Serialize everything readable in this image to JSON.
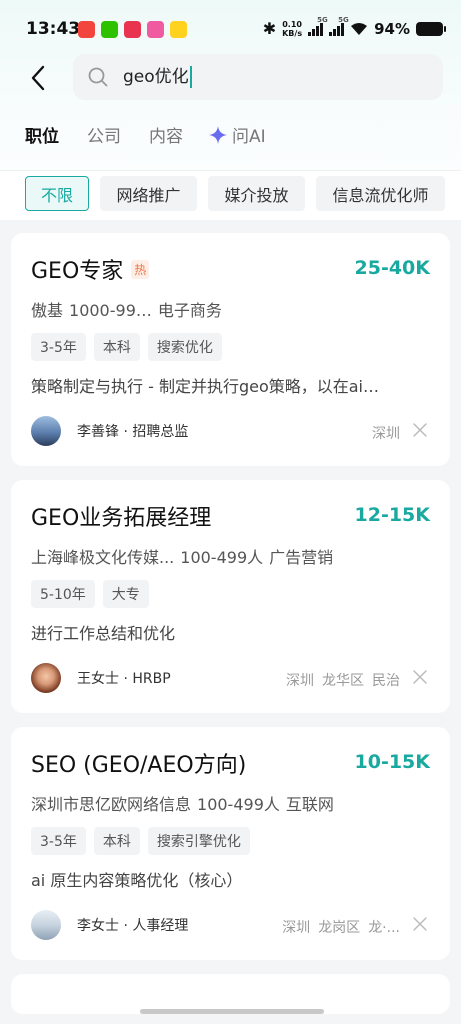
{
  "status_bar": {
    "time": "13:43",
    "speed_value": "0.10",
    "speed_unit": "KB/s",
    "net1": "5G",
    "net2": "5G",
    "battery": "94%"
  },
  "search": {
    "query": "geo优化"
  },
  "tabs": [
    "职位",
    "公司",
    "内容",
    "问AI"
  ],
  "filters": [
    "不限",
    "网络推广",
    "媒介投放",
    "信息流优化师"
  ],
  "jobs": [
    {
      "title": "GEO专家",
      "hot_badge": "热",
      "salary": "25-40K",
      "company": "傲基",
      "size": "1000-99…",
      "industry": "电子商务",
      "tags": [
        "3-5年",
        "本科",
        "搜索优化"
      ],
      "desc": "策略制定与执行 - 制定并执行geo策略，以在ai…",
      "recruiter": "李善锋 · 招聘总监",
      "location": [
        "深圳"
      ]
    },
    {
      "title": "GEO业务拓展经理",
      "salary": "12-15K",
      "company": "上海峰极文化传媒...",
      "size": "100-499人",
      "industry": "广告营销",
      "tags": [
        "5-10年",
        "大专"
      ],
      "desc": "进行工作总结和优化",
      "recruiter": "王女士 · HRBP",
      "location": [
        "深圳",
        "龙华区",
        "民治"
      ]
    },
    {
      "title": "SEO (GEO/AEO方向)",
      "salary": "10-15K",
      "company": "深圳市思亿欧网络信息",
      "size": "100-499人",
      "industry": "互联网",
      "tags": [
        "3-5年",
        "本科",
        "搜索引擎优化"
      ],
      "desc": "ai 原生内容策略优化（核心）",
      "recruiter": "李女士 · 人事经理",
      "location": [
        "深圳",
        "龙岗区",
        "龙·..."
      ]
    }
  ],
  "colors": {
    "accent": "#1aa9a0",
    "hot": "#f0774a"
  }
}
